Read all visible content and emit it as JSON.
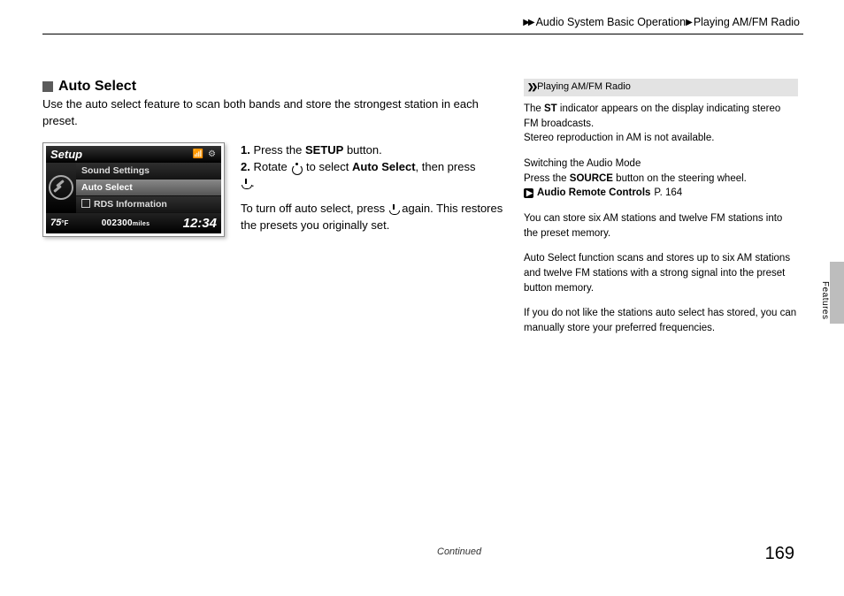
{
  "breadcrumb": {
    "seg1": "Audio System Basic Operation",
    "seg2": "Playing AM/FM Radio"
  },
  "section": {
    "title": "Auto Select",
    "intro": "Use the auto select feature to scan both bands and store the strongest station in each preset."
  },
  "screenshot": {
    "header": "Setup",
    "item1": "Sound Settings",
    "item2": "Auto Select",
    "item3": "RDS Information",
    "temp_value": "75",
    "temp_unit": "°F",
    "odo_value": "002300",
    "odo_unit": "miles",
    "clock": "12:34"
  },
  "steps": {
    "s1a": "1.",
    "s1b": " Press the ",
    "s1c": "SETUP",
    "s1d": " button.",
    "s2a": "2.",
    "s2b": " Rotate ",
    "s2c": " to select ",
    "s2d": "Auto Select",
    "s2e": ", then press ",
    "s2f": ".",
    "off1": "To turn off auto select, press ",
    "off2": " again. This restores the presets you originally set."
  },
  "sidebar": {
    "title": "Playing AM/FM Radio",
    "p1a": "The ",
    "p1b": "ST",
    "p1c": " indicator appears on the display indicating stereo FM broadcasts.",
    "p1d": "Stereo reproduction in AM is not available.",
    "p2a": "Switching the Audio Mode",
    "p2b": "Press the ",
    "p2c": "SOURCE",
    "p2d": " button on the steering wheel.",
    "link_label": "Audio Remote Controls",
    "link_page": " P. 164",
    "p3": "You can store six AM stations and twelve FM stations into the preset memory.",
    "p4": "Auto Select function scans and stores up to six AM stations and twelve FM stations with a strong signal into the preset button memory.",
    "p5": "If you do not like the stations auto select has stored, you can manually store your preferred frequencies."
  },
  "tab": {
    "label": "Features"
  },
  "footer": {
    "continued": "Continued",
    "page": "169"
  }
}
